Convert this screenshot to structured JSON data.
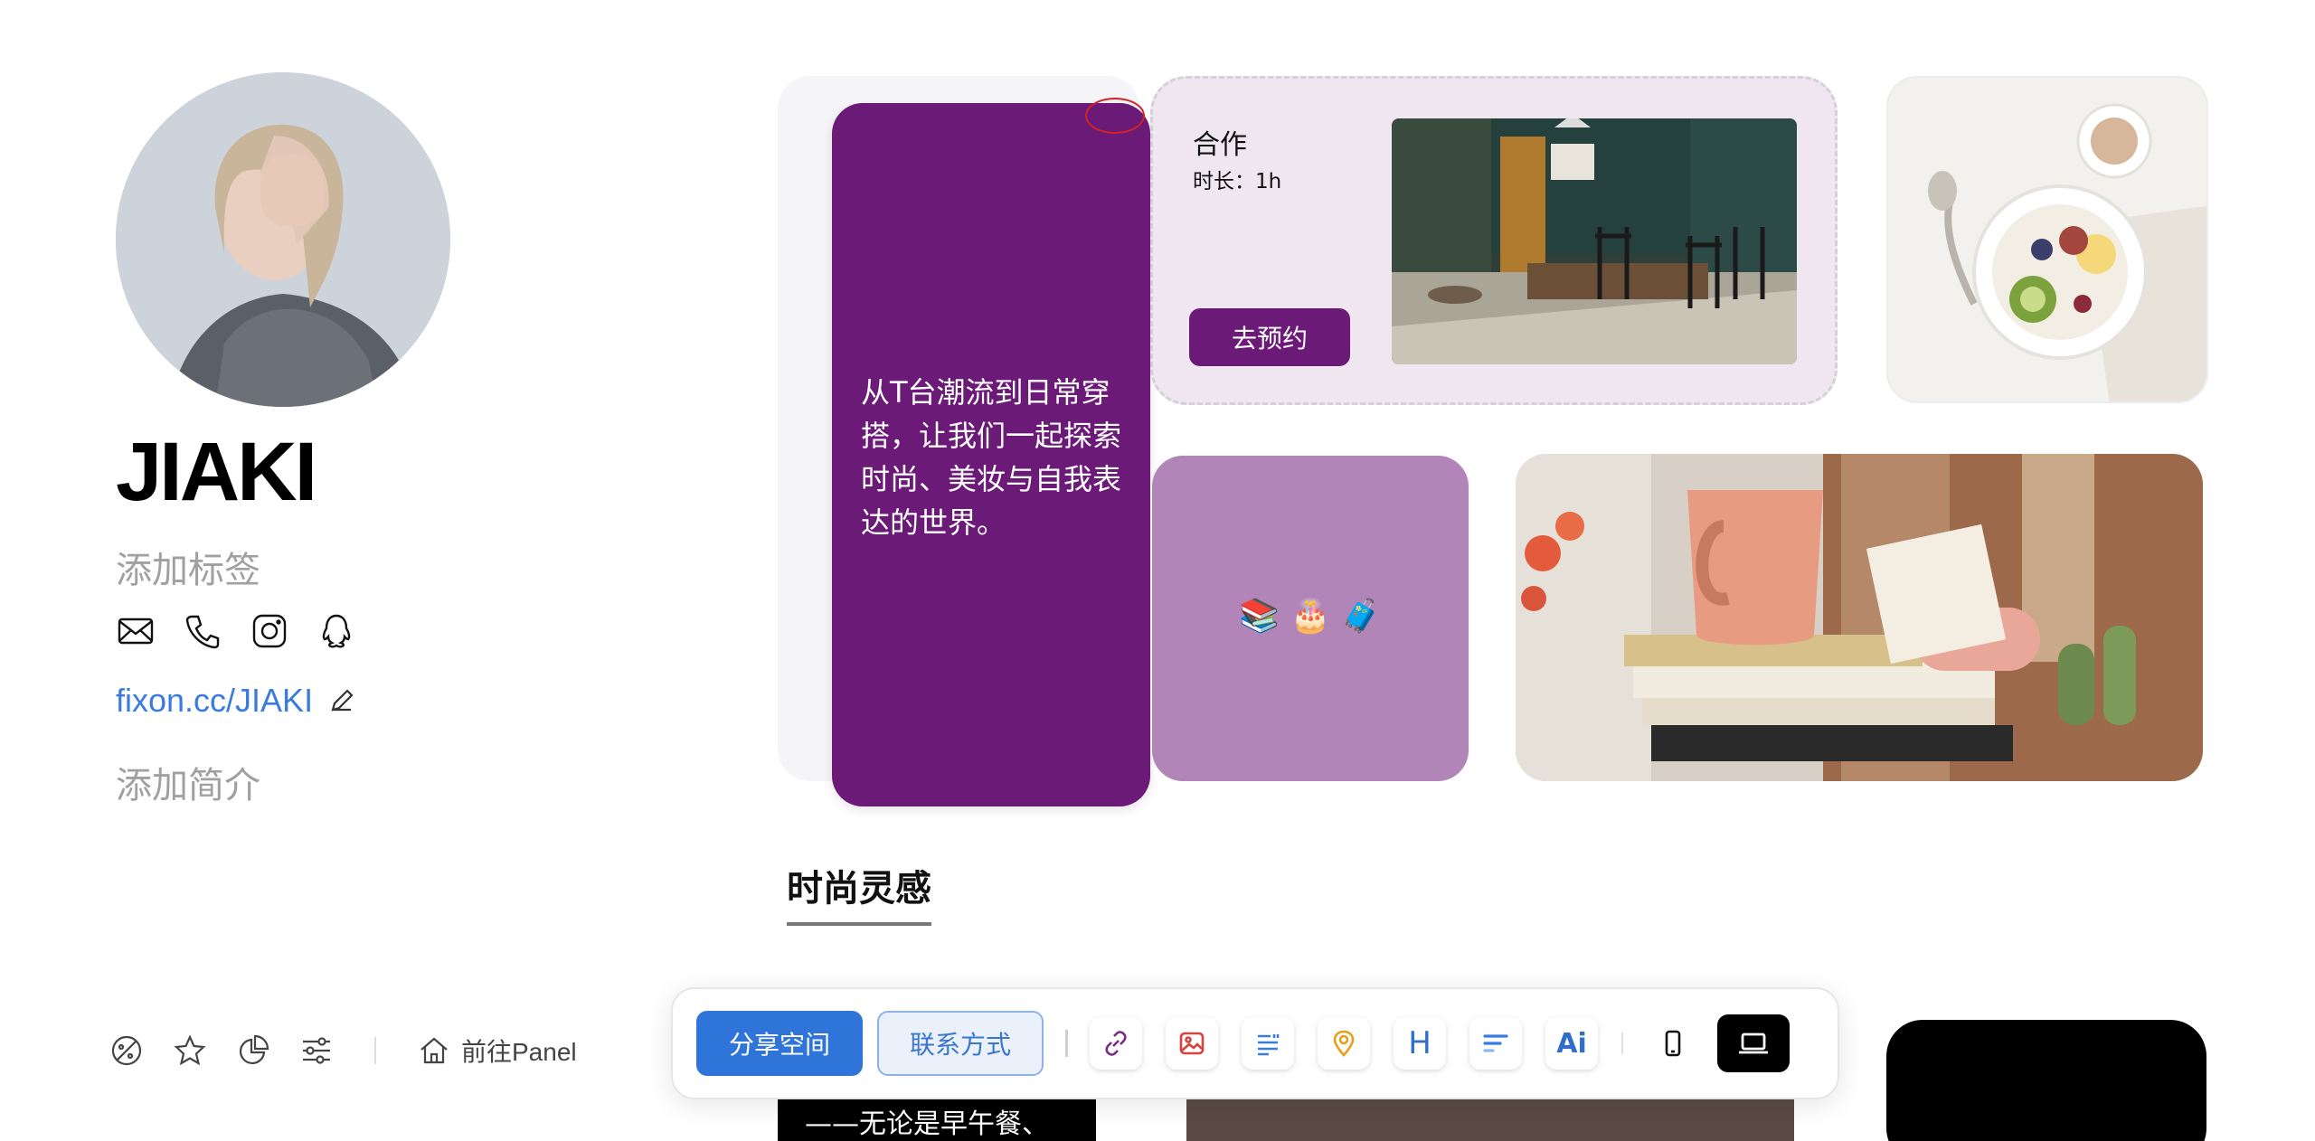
{
  "profile": {
    "name": "JIAKI",
    "add_tag": "添加标签",
    "link": "fixon.cc/JIAKI",
    "add_bio": "添加简介",
    "social_icons": [
      "mail-icon",
      "phone-icon",
      "instagram-icon",
      "qq-icon"
    ]
  },
  "bottom_bar": {
    "panel_label": "前往Panel",
    "icons": [
      "palette-icon",
      "star-icon",
      "pie-chart-icon",
      "sliders-icon",
      "home-icon"
    ]
  },
  "cards": {
    "text_card": {
      "text": "从T台潮流到日常穿搭，让我们一起探索时尚、美妆与自我表达的世界。"
    },
    "booking": {
      "title": "合作",
      "duration": "时长：1h",
      "button": "去预约"
    },
    "emoji_card": {
      "emojis": "📚 🎂 🧳"
    },
    "peek_text": "——无论是早午餐、"
  },
  "section": {
    "title": "时尚灵感"
  },
  "toolbar": {
    "share_label": "分享空间",
    "contact_label": "联系方式",
    "tools": [
      "link-icon",
      "image-icon",
      "text-icon",
      "location-icon",
      "heading-icon",
      "sections-icon",
      "ai-icon"
    ],
    "heading_glyph": "H",
    "ai_glyph": "Ai",
    "devices": [
      "mobile-icon",
      "desktop-icon"
    ]
  },
  "colors": {
    "purple_dark": "#6b1a78",
    "purple_light": "#b285b9",
    "booking_bg": "#efe6f0",
    "link_blue": "#3a7be0",
    "primary_blue": "#2f74d8"
  }
}
